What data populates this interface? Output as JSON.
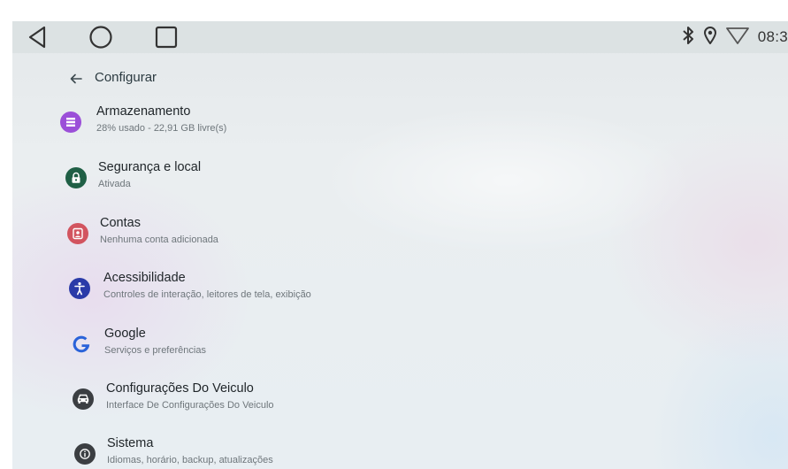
{
  "status_bar": {
    "clock": "08:3",
    "icons": [
      "bluetooth-icon",
      "location-icon",
      "wifi-icon"
    ]
  },
  "nav_bar": {
    "icons": [
      "back-triangle-icon",
      "home-circle-icon",
      "recents-square-icon"
    ]
  },
  "toolbar": {
    "title": "Configurar"
  },
  "settings": {
    "items": [
      {
        "title": "Armazenamento",
        "subtitle": "28% usado - 22,91 GB livre(s)",
        "icon": "storage-icon",
        "color": "#9b4fd8"
      },
      {
        "title": "Segurança e local",
        "subtitle": "Ativada",
        "icon": "lock-icon",
        "color": "#1f5f45"
      },
      {
        "title": "Contas",
        "subtitle": "Nenhuma conta adicionada",
        "icon": "account-icon",
        "color": "#d2545f"
      },
      {
        "title": "Acessibilidade",
        "subtitle": "Controles de interação, leitores de tela, exibição",
        "icon": "accessibility-icon",
        "color": "#2a3aa8"
      },
      {
        "title": "Google",
        "subtitle": "Serviços e preferências",
        "icon": "google-icon",
        "color": "#2a63d9"
      },
      {
        "title": "Configurações Do Veiculo",
        "subtitle": "Interface De Configurações Do Veiculo",
        "icon": "car-icon",
        "color": "#3b3e42"
      },
      {
        "title": "Sistema",
        "subtitle": "Idiomas, horário, backup, atualizações",
        "icon": "info-icon",
        "color": "#3b3e42"
      }
    ]
  }
}
